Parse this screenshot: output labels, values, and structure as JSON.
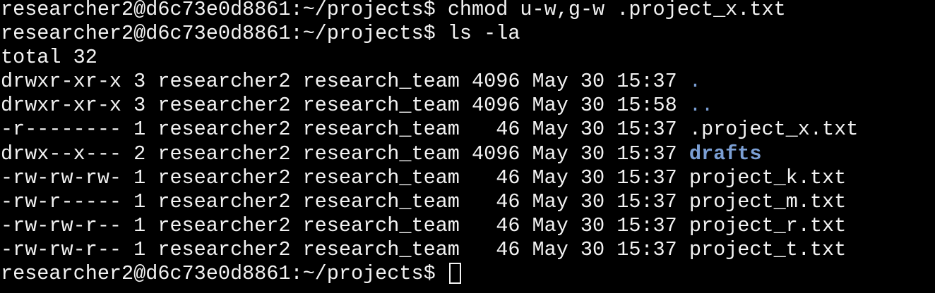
{
  "terminal": {
    "prompt": "researcher2@d6c73e0d8861:~/projects$",
    "lines": [
      {
        "type": "command",
        "command": "chmod u-w,g-w .project_x.txt"
      },
      {
        "type": "command",
        "command": "ls -la"
      },
      {
        "type": "output",
        "text": "total 32"
      }
    ],
    "listing": [
      {
        "meta": "drwxr-xr-x 3 researcher2 research_team 4096 May 30 15:37 ",
        "name": ".",
        "kind": "dir-dot"
      },
      {
        "meta": "drwxr-xr-x 3 researcher2 research_team 4096 May 30 15:58 ",
        "name": "..",
        "kind": "dir-dot"
      },
      {
        "meta": "-r-------- 1 researcher2 research_team   46 May 30 15:37 ",
        "name": ".project_x.txt",
        "kind": "file"
      },
      {
        "meta": "drwx--x--- 2 researcher2 research_team 4096 May 30 15:37 ",
        "name": "drafts",
        "kind": "dir-bold"
      },
      {
        "meta": "-rw-rw-rw- 1 researcher2 research_team   46 May 30 15:37 ",
        "name": "project_k.txt",
        "kind": "file"
      },
      {
        "meta": "-rw-r----- 1 researcher2 research_team   46 May 30 15:37 ",
        "name": "project_m.txt",
        "kind": "file"
      },
      {
        "meta": "-rw-rw-r-- 1 researcher2 research_team   46 May 30 15:37 ",
        "name": "project_r.txt",
        "kind": "file"
      },
      {
        "meta": "-rw-rw-r-- 1 researcher2 research_team   46 May 30 15:37 ",
        "name": "project_t.txt",
        "kind": "file"
      }
    ],
    "colors": {
      "background": "#000000",
      "foreground": "#f2f2f2",
      "directory": "#7b9fd4"
    }
  }
}
